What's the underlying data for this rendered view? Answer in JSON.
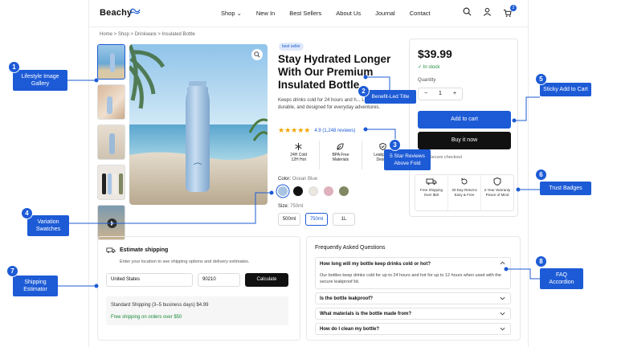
{
  "nav": {
    "logo": "Beachy",
    "menu": [
      "Shop ⌄",
      "New In",
      "Best Sellers",
      "About Us",
      "Journal",
      "Contact"
    ],
    "cart_count": "2"
  },
  "breadcrumb": "Home  >  Shop  >  Drinkware  >  Insulated Bottle",
  "product": {
    "badge": "best seller",
    "title": "Stay Hydrated Longer With Our Premium Insulated Bottle",
    "description": "Keeps drinks cold for 24 hours and h... Leakproof, durable, and designed for everyday adventures.",
    "rating_text": "4.9 (1,248 reviews)",
    "stars": "★★★★★",
    "features": [
      {
        "label1": "24H Cold",
        "label2": "12H Hot"
      },
      {
        "label1": "BPA Free",
        "label2": "Materials"
      },
      {
        "label1": "Leakproof",
        "label2": "Design"
      }
    ],
    "color_label": "Color:",
    "color_value": "Ocean Blue",
    "swatches": [
      "#a9c4e2",
      "#111111",
      "#ebe7e0",
      "#deb1bd",
      "#7f8862"
    ],
    "size_label": "Size:",
    "size_value": "750ml",
    "sizes": [
      "500ml",
      "750ml",
      "1L"
    ]
  },
  "buybox": {
    "price": "$39.99",
    "stock": "✓ In stock",
    "qty_label": "Quantity",
    "qty_minus": "−",
    "qty_value": "1",
    "qty_plus": "+",
    "add_to_cart": "Add to cart",
    "buy_now": "Buy it now",
    "secure": "Secure checkout",
    "trust": [
      {
        "l1": "Free Shipping",
        "l2": "Over $50"
      },
      {
        "l1": "30-Day Returns",
        "l2": "Easy & Free"
      },
      {
        "l1": "2-Year Warranty",
        "l2": "Peace of Mind"
      }
    ]
  },
  "shipping": {
    "title": "Estimate shipping",
    "subtitle": "Enter your location to see shipping options and delivery estimates.",
    "country": "United States",
    "zip": "90210",
    "button": "Calculate",
    "rate": "Standard Shipping (3–5 business days)   $4.99",
    "free": "Free shipping on orders over $50"
  },
  "faq": {
    "title": "Frequently Asked Questions",
    "open_q": "How long will my bottle keep drinks cold or hot?",
    "open_a": "Our bottles keep drinks cold for up to 24 hours and hot for up to 12 hours when used with the secure leakproof lid.",
    "items": [
      "Is the bottle leakproof?",
      "What materials is the bottle made from?",
      "How do I clean my bottle?"
    ]
  },
  "callouts": {
    "c1": "Lifestyle Image Gallery",
    "c2": "Benefit-Led Title",
    "c3": "5 Star Reviews Above Fold",
    "c4": "Variation Swatches",
    "c5": "Sticky Add to Cart",
    "c6": "Trust Badges",
    "c7": "Shipping Estimator",
    "c8": "FAQ Accordion"
  },
  "numbers": [
    "1",
    "2",
    "3",
    "4",
    "5",
    "6",
    "7",
    "8"
  ],
  "colors": {
    "accent": "#1d5bd6",
    "star": "#f2a400",
    "success": "#1a8a3a"
  }
}
